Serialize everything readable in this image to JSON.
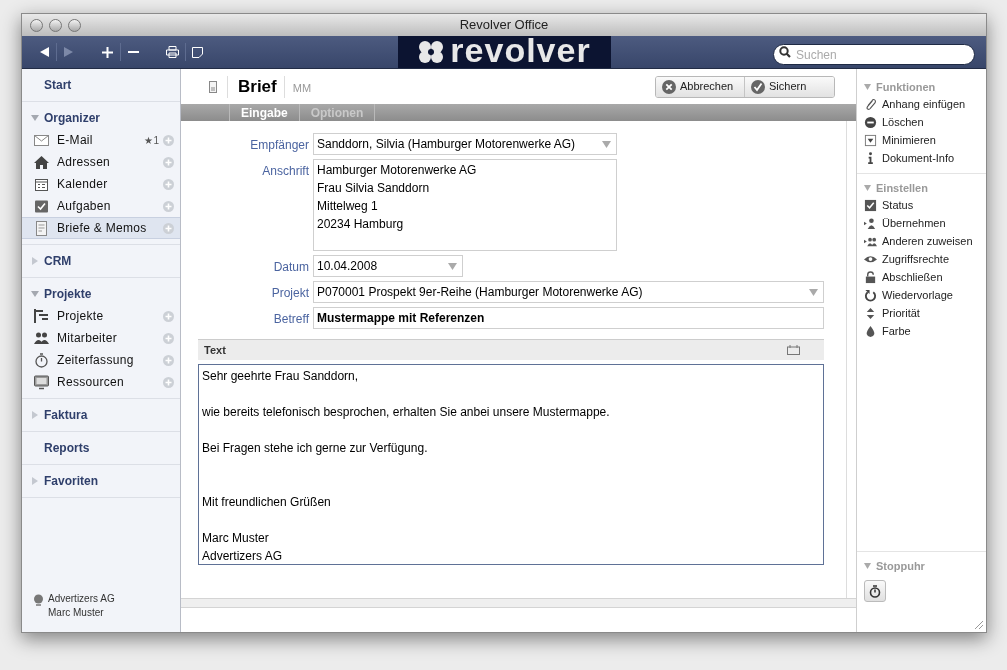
{
  "window": {
    "title": "Revolver Office"
  },
  "toolbar": {
    "logo": "revolver",
    "search": {
      "placeholder": "Suchen"
    }
  },
  "sidebar": {
    "sections": [
      {
        "kind": "link",
        "label": "Start"
      },
      {
        "kind": "group",
        "label": "Organizer",
        "expanded": true,
        "items": [
          {
            "label": "E-Mail",
            "badge": "★1",
            "selected": false
          },
          {
            "label": "Adressen",
            "selected": false
          },
          {
            "label": "Kalender",
            "selected": false
          },
          {
            "label": "Aufgaben",
            "selected": false
          },
          {
            "label": "Briefe & Memos",
            "selected": true
          }
        ]
      },
      {
        "kind": "group",
        "label": "CRM",
        "expanded": false
      },
      {
        "kind": "group",
        "label": "Projekte",
        "expanded": true,
        "items": [
          {
            "label": "Projekte",
            "selected": false
          },
          {
            "label": "Mitarbeiter",
            "selected": false
          },
          {
            "label": "Zeiterfassung",
            "selected": false
          },
          {
            "label": "Ressourcen",
            "selected": false
          }
        ]
      },
      {
        "kind": "group",
        "label": "Faktura",
        "expanded": false
      },
      {
        "kind": "link",
        "label": "Reports"
      },
      {
        "kind": "group",
        "label": "Favoriten",
        "expanded": false
      }
    ],
    "footer": {
      "company": "Advertizers AG",
      "user": "Marc Muster"
    }
  },
  "document": {
    "type": "Brief",
    "initials": "MM",
    "buttons": [
      "Abbrechen",
      "Sichern"
    ],
    "tabs": [
      {
        "label": "Eingabe",
        "selected": true
      },
      {
        "label": "Optionen",
        "selected": false
      }
    ],
    "fields": [
      {
        "kind": "contact",
        "label": "Empfänger",
        "value": "Sanddorn, Silvia (Hamburger Motorenwerke AG)"
      },
      {
        "kind": "address",
        "label": "Anschrift",
        "value": "Hamburger Motorenwerke AG\nFrau Silvia Sanddorn\nMittelweg 1\n20234 Hamburg"
      },
      {
        "kind": "date",
        "label": "Datum",
        "value": "10.04.2008"
      },
      {
        "kind": "project",
        "label": "Projekt",
        "value": "P070001 Prospekt 9er-Reihe (Hamburger Motorenwerke AG)"
      },
      {
        "kind": "subject",
        "label": "Betreff",
        "value": "Mustermappe mit Referenzen"
      }
    ],
    "text": {
      "title": "Text",
      "value": "Sehr geehrte Frau Sanddorn,\n\nwie bereits telefonisch besprochen, erhalten Sie anbei unsere Mustermappe.\n\nBei Fragen stehe ich gerne zur Verfügung.\n\n\nMit freundlichen Grüßen\n\nMarc Muster\nAdvertizers AG"
    }
  },
  "panel": {
    "sections": [
      {
        "kind": "list",
        "title": "Funktionen",
        "expanded": true,
        "items": [
          "Anhang einfügen",
          "Löschen",
          "Minimieren",
          "Dokument-Info"
        ]
      },
      {
        "kind": "list",
        "title": "Einstellen",
        "expanded": true,
        "items": [
          "Status",
          "Übernehmen",
          "Anderen zuweisen",
          "Zugriffsrechte",
          "Abschließen",
          "Wiedervorlage",
          "Priorität",
          "Farbe"
        ]
      },
      {
        "kind": "timer",
        "title": "Stoppuhr",
        "expanded": true
      }
    ]
  }
}
